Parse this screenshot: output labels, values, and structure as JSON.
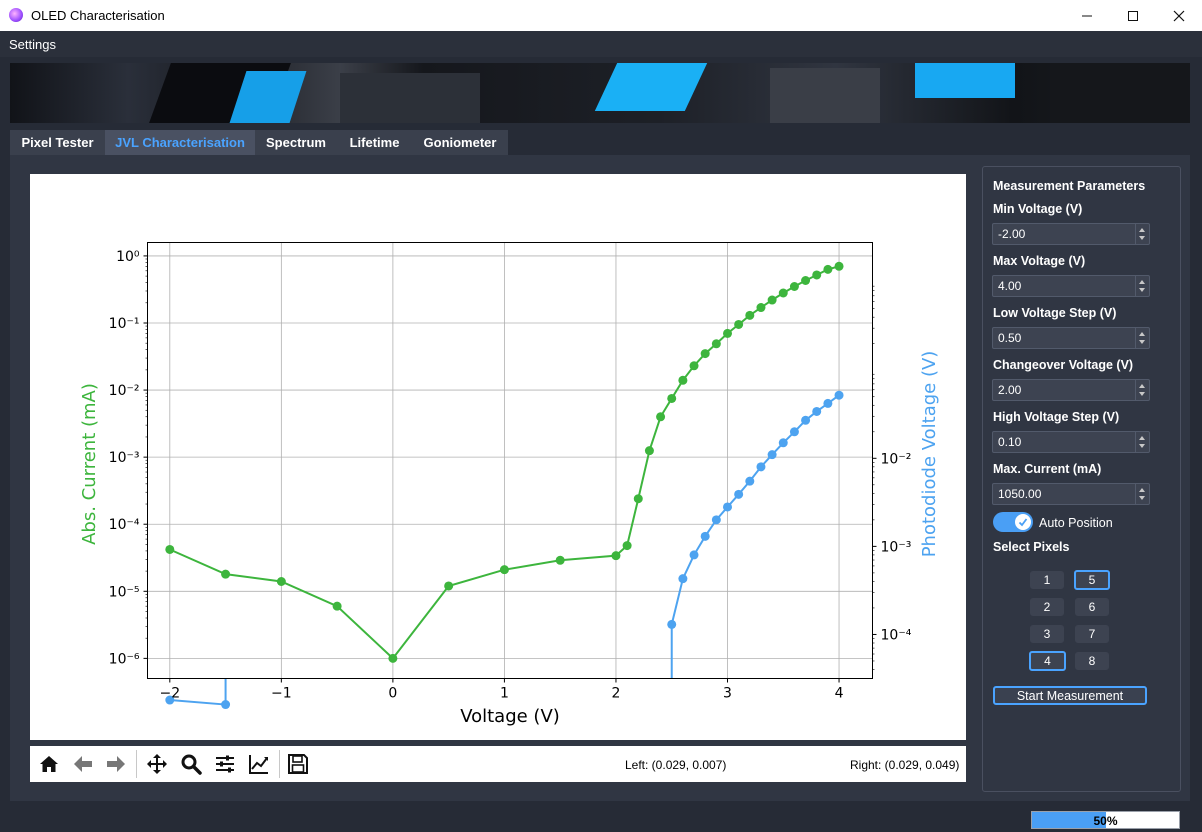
{
  "window": {
    "title": "OLED Characterisation"
  },
  "menu": {
    "settings": "Settings"
  },
  "tabs": [
    {
      "label": "Pixel Tester"
    },
    {
      "label": "JVL Characterisation"
    },
    {
      "label": "Spectrum"
    },
    {
      "label": "Lifetime"
    },
    {
      "label": "Goniometer"
    }
  ],
  "active_tab": "JVL Characterisation",
  "colors": {
    "accent": "#4aa3ff",
    "current_series": "#3db53d",
    "photodiode_series": "#4da3f0"
  },
  "chart_data": {
    "type": "line",
    "xlabel": "Voltage (V)",
    "ylabel_left": "Abs. Current (mA)",
    "ylabel_right": "Photodiode Voltage (V)",
    "x_ticks": [
      "−2",
      "−1",
      "0",
      "1",
      "2",
      "3",
      "4"
    ],
    "y_left_ticks": [
      "10⁻⁶",
      "10⁻⁵",
      "10⁻⁴",
      "10⁻³",
      "10⁻²",
      "10⁻¹",
      "10⁰"
    ],
    "y_right_ticks": [
      "10⁻⁴",
      "10⁻³",
      "10⁻²"
    ],
    "xlim": [
      -2.2,
      4.3
    ],
    "ylim_left_log": [
      -6.3,
      0.2
    ],
    "ylim_right_log": [
      -4.5,
      0.45
    ],
    "grid": true,
    "series": [
      {
        "name": "Abs. Current (mA)",
        "axis": "left",
        "x": [
          -2,
          -1.5,
          -1,
          -0.5,
          0,
          0.5,
          1,
          1.5,
          2,
          2.1,
          2.2,
          2.3,
          2.4,
          2.5,
          2.6,
          2.7,
          2.8,
          2.9,
          3.0,
          3.1,
          3.2,
          3.3,
          3.4,
          3.5,
          3.6,
          3.7,
          3.8,
          3.9,
          4.0
        ],
        "y": [
          4.2e-05,
          1.8e-05,
          1.4e-05,
          6e-06,
          1e-06,
          1.2e-05,
          2.1e-05,
          2.9e-05,
          3.4e-05,
          4.8e-05,
          0.00024,
          0.00125,
          0.004,
          0.0075,
          0.014,
          0.023,
          0.035,
          0.049,
          0.07,
          0.095,
          0.13,
          0.17,
          0.22,
          0.28,
          0.35,
          0.43,
          0.52,
          0.63,
          0.7
        ]
      },
      {
        "name": "Photodiode Voltage (V)",
        "axis": "right",
        "x": [
          -2,
          -1.5,
          2.5,
          2.6,
          2.7,
          2.8,
          2.9,
          3.0,
          3.1,
          3.2,
          3.3,
          3.4,
          3.5,
          3.6,
          3.7,
          3.8,
          3.9,
          4.0
        ],
        "y": [
          1.8e-05,
          1.6e-05,
          0.00013,
          0.00043,
          0.0008,
          0.0013,
          0.002,
          0.0028,
          0.0039,
          0.0055,
          0.008,
          0.011,
          0.015,
          0.02,
          0.027,
          0.034,
          0.042,
          0.052
        ]
      }
    ]
  },
  "plot_toolbar": {
    "icons": [
      "home-icon",
      "back-arrow-icon",
      "forward-arrow-icon",
      "pan-move-icon",
      "zoom-magnifier-icon",
      "configure-subplots-icon",
      "edit-axis-icon",
      "save-floppy-icon"
    ],
    "left_coord": "Left: (0.029, 0.007)",
    "right_coord": "Right: (0.029, 0.049)"
  },
  "params": {
    "title": "Measurement Parameters",
    "min_voltage_label": "Min Voltage (V)",
    "min_voltage": "-2.00",
    "max_voltage_label": "Max Voltage (V)",
    "max_voltage": "4.00",
    "low_step_label": "Low Voltage Step (V)",
    "low_step": "0.50",
    "changeover_label": "Changeover Voltage (V)",
    "changeover": "2.00",
    "high_step_label": "High Voltage Step (V)",
    "high_step": "0.10",
    "max_current_label": "Max. Current (mA)",
    "max_current": "1050.00",
    "auto_position_label": "Auto Position",
    "auto_position_on": true,
    "select_pixels_label": "Select Pixels",
    "pixels": [
      {
        "label": "1",
        "selected": false
      },
      {
        "label": "5",
        "selected": true
      },
      {
        "label": "2",
        "selected": false
      },
      {
        "label": "6",
        "selected": false
      },
      {
        "label": "3",
        "selected": false
      },
      {
        "label": "7",
        "selected": false
      },
      {
        "label": "4",
        "selected": true
      },
      {
        "label": "8",
        "selected": false
      }
    ],
    "start_button": "Start Measurement"
  },
  "status": {
    "progress_percent": 50,
    "progress_text": "50%"
  }
}
